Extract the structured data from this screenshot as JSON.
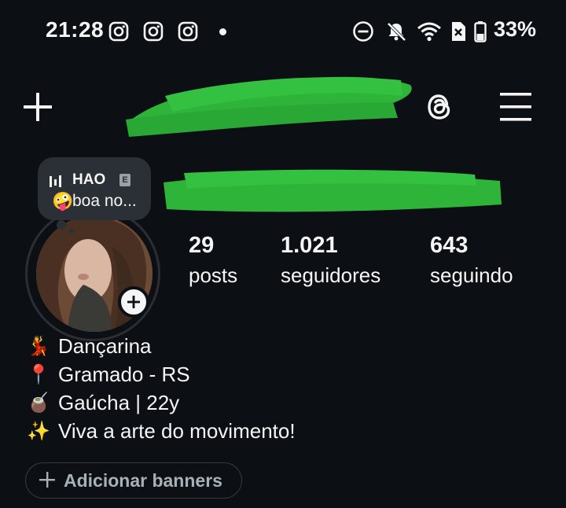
{
  "status_bar": {
    "time": "21:28",
    "notification_icons": [
      "instagram-icon",
      "instagram-icon",
      "instagram-icon"
    ],
    "right_icons": [
      "do-not-disturb-icon",
      "bell-off-icon",
      "wifi-icon",
      "no-sim-icon",
      "battery-icon"
    ],
    "battery_percent": "33%"
  },
  "top_nav": {
    "create_icon": "plus-icon",
    "username_redacted": true,
    "threads_icon": "threads-icon",
    "menu_icon": "hamburger-menu-icon",
    "redaction_color": "#2fb43a"
  },
  "note": {
    "title": "HAO",
    "badge": "E",
    "emoji": "🤪",
    "text": "boa no..."
  },
  "stats": [
    {
      "number": "29",
      "label": "posts"
    },
    {
      "number": "1.021",
      "label": "seguidores"
    },
    {
      "number": "643",
      "label": "seguindo"
    }
  ],
  "bio": [
    {
      "emoji": "💃",
      "text": "Dançarina"
    },
    {
      "emoji": "📍",
      "text": "Gramado - RS"
    },
    {
      "emoji": "🧉",
      "text": "Gaúcha | 22y"
    },
    {
      "emoji": "✨",
      "text": "Viva a arte do movimento!"
    }
  ],
  "banner_button": {
    "icon": "plus-icon",
    "label": "Adicionar banners"
  },
  "colors": {
    "background": "#0c1014",
    "text": "#f5f5f5",
    "note_bubble": "#2b3036",
    "muted_text": "#a8b0b8"
  }
}
